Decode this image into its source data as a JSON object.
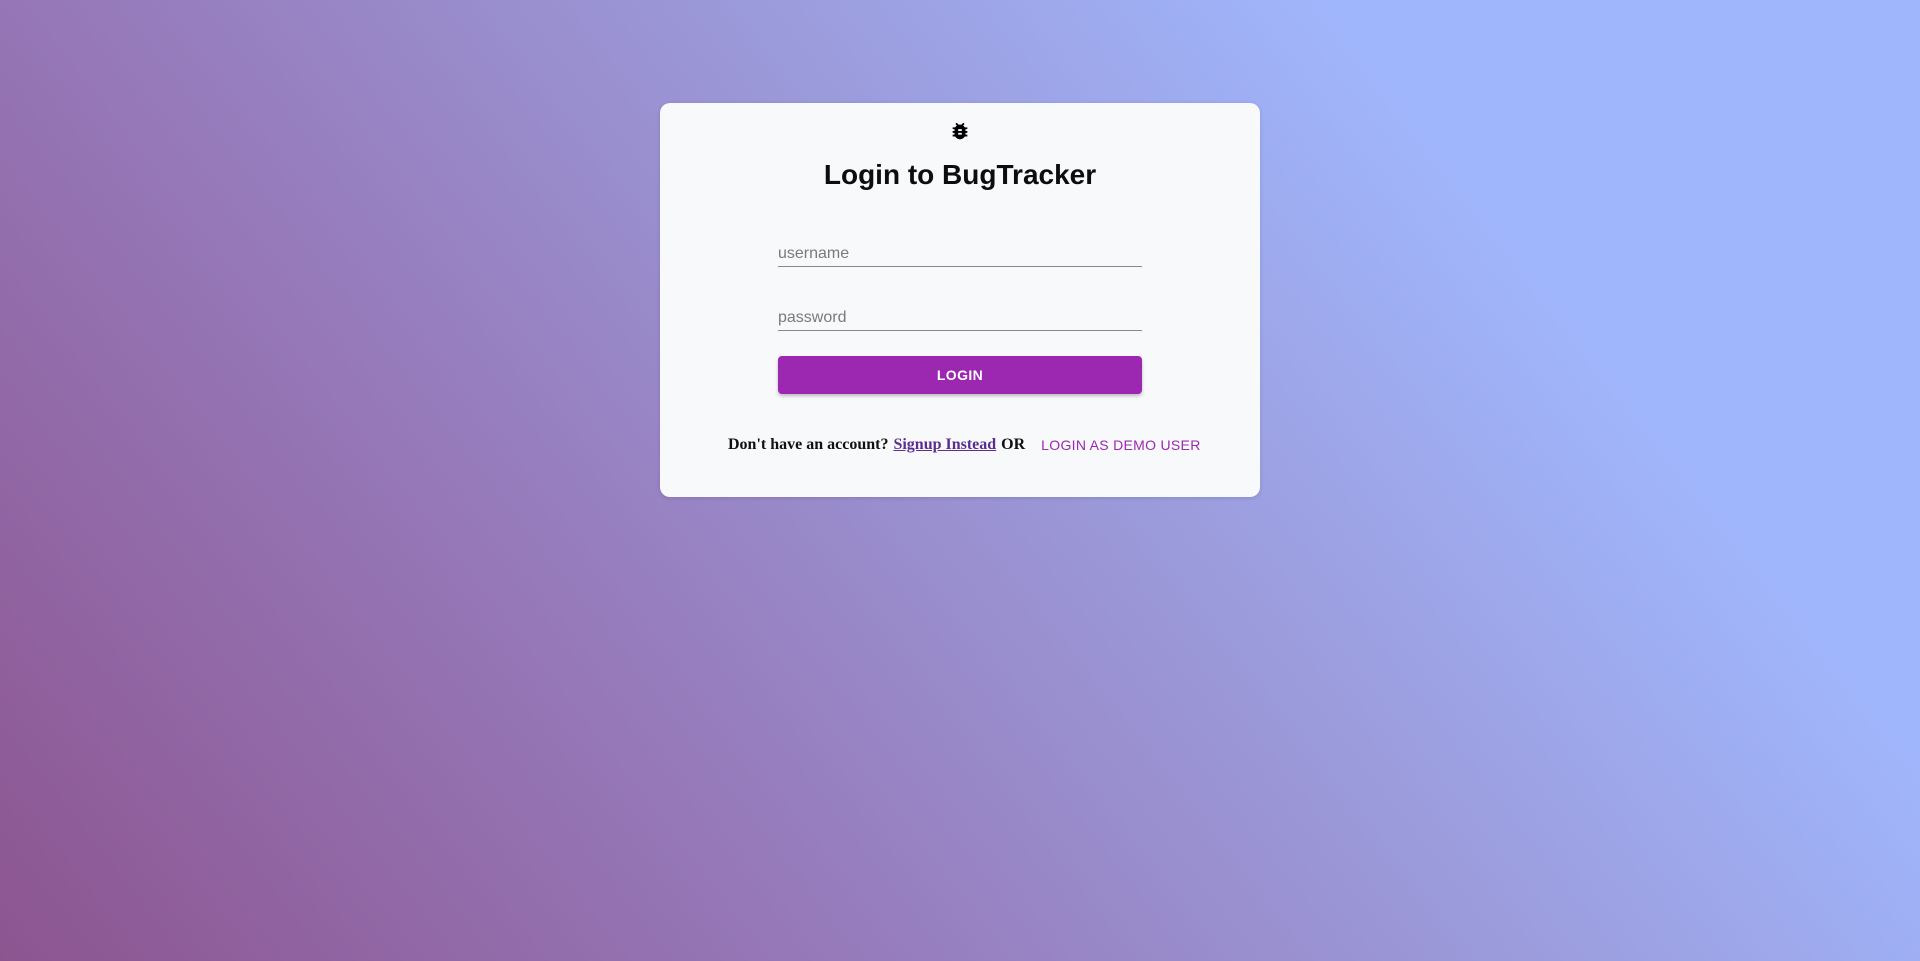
{
  "login_card": {
    "logo_icon": "bug-icon",
    "title": "Login to BugTracker",
    "username": {
      "value": "",
      "placeholder": "username"
    },
    "password": {
      "value": "",
      "placeholder": "password"
    },
    "login_button_label": "LOGIN",
    "footer": {
      "prompt_text": "Don't have an account?",
      "signup_link_label": "Signup Instead",
      "or_text": "OR",
      "demo_button_label": "LOGIN AS DEMO USER"
    }
  },
  "colors": {
    "accent": "#9c27b0",
    "link": "#5b2d8c",
    "card_background": "#f8f9fb",
    "gradient_start": "#8c5590",
    "gradient_end": "#a0b6fc"
  }
}
